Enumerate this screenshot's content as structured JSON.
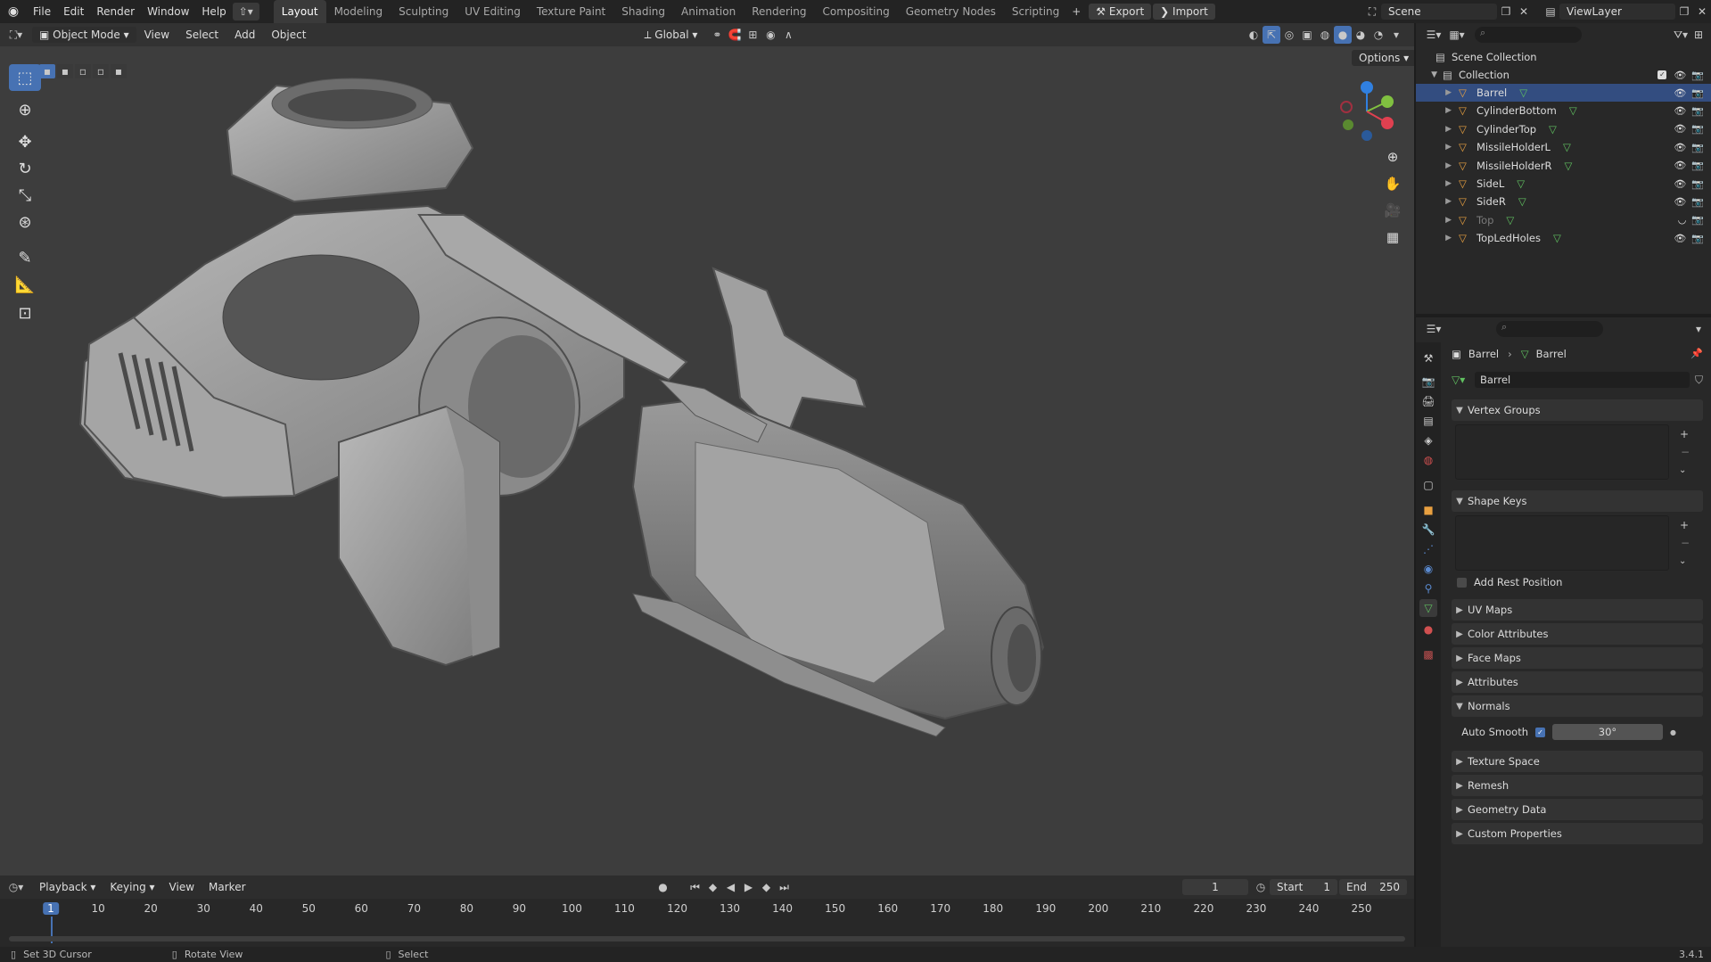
{
  "topbar": {
    "menus": [
      "File",
      "Edit",
      "Render",
      "Window",
      "Help"
    ],
    "workspaces": [
      "Layout",
      "Modeling",
      "Sculpting",
      "UV Editing",
      "Texture Paint",
      "Shading",
      "Animation",
      "Rendering",
      "Compositing",
      "Geometry Nodes",
      "Scripting"
    ],
    "active_workspace": "Layout",
    "export_label": "Export",
    "import_label": "Import",
    "scene_name": "Scene",
    "viewlayer_name": "ViewLayer"
  },
  "viewport": {
    "mode": "Object Mode",
    "menus": [
      "View",
      "Select",
      "Add",
      "Object"
    ],
    "orientation": "Global",
    "options_label": "Options"
  },
  "outliner": {
    "scene_collection": "Scene Collection",
    "collection": "Collection",
    "items": [
      {
        "name": "Barrel",
        "selected": true,
        "visible": true
      },
      {
        "name": "CylinderBottom",
        "selected": false,
        "visible": true
      },
      {
        "name": "CylinderTop",
        "selected": false,
        "visible": true
      },
      {
        "name": "MissileHolderL",
        "selected": false,
        "visible": true
      },
      {
        "name": "MissileHolderR",
        "selected": false,
        "visible": true
      },
      {
        "name": "SideL",
        "selected": false,
        "visible": true
      },
      {
        "name": "SideR",
        "selected": false,
        "visible": true
      },
      {
        "name": "Top",
        "selected": false,
        "visible": false
      },
      {
        "name": "TopLedHoles",
        "selected": false,
        "visible": true
      }
    ]
  },
  "properties": {
    "breadcrumb_object": "Barrel",
    "breadcrumb_data": "Barrel",
    "mesh_name": "Barrel",
    "vertex_groups": "Vertex Groups",
    "shape_keys": "Shape Keys",
    "add_rest_position": "Add Rest Position",
    "panels_collapsed_a": [
      "UV Maps",
      "Color Attributes",
      "Face Maps",
      "Attributes"
    ],
    "normals": "Normals",
    "auto_smooth": "Auto Smooth",
    "auto_smooth_angle": "30°",
    "panels_collapsed_b": [
      "Texture Space",
      "Remesh",
      "Geometry Data",
      "Custom Properties"
    ]
  },
  "timeline": {
    "menus": [
      "Playback",
      "Keying",
      "View",
      "Marker"
    ],
    "current_frame": "1",
    "start_label": "Start",
    "start_value": "1",
    "end_label": "End",
    "end_value": "250",
    "ticks": [
      "1",
      "10",
      "20",
      "30",
      "40",
      "50",
      "60",
      "70",
      "80",
      "90",
      "100",
      "110",
      "120",
      "130",
      "140",
      "150",
      "160",
      "170",
      "180",
      "190",
      "200",
      "210",
      "220",
      "230",
      "240",
      "250"
    ]
  },
  "statusbar": {
    "hint1": "Set 3D Cursor",
    "hint2": "Rotate View",
    "hint3": "Select",
    "version": "3.4.1"
  },
  "colors": {
    "accent": "#4772b3",
    "mesh_icon": "#e8a040",
    "data_icon": "#60c060",
    "axis_x": "#e04050",
    "axis_y": "#80c040",
    "axis_z": "#3080e0"
  }
}
